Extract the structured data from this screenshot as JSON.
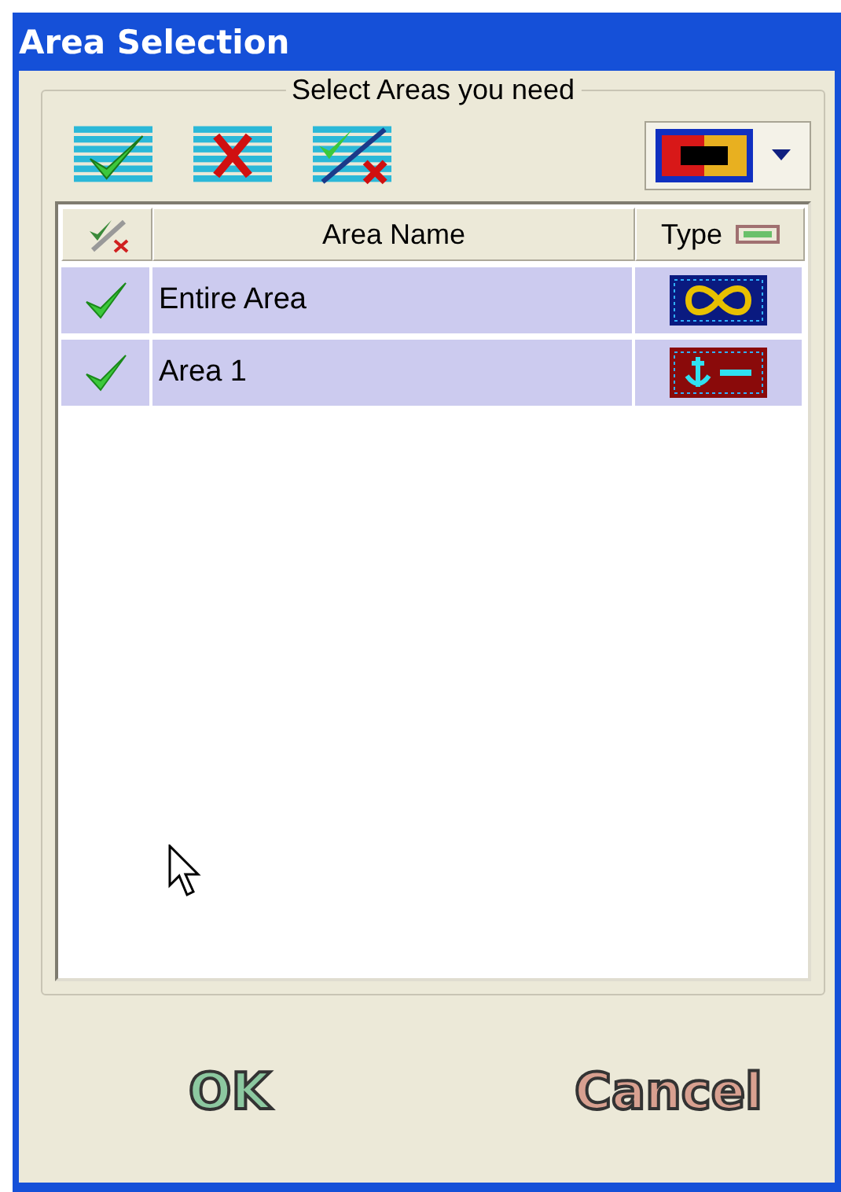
{
  "window": {
    "title": "Area Selection"
  },
  "group": {
    "legend": "Select Areas you need"
  },
  "table": {
    "columns": [
      "Area Name",
      "Type"
    ],
    "rows": [
      {
        "checked": true,
        "selected": true,
        "name": "Entire Area",
        "kind": "infinity"
      },
      {
        "checked": true,
        "selected": true,
        "name": "Area 1",
        "kind": "anchor"
      }
    ]
  },
  "buttons": [
    {
      "label": "OK",
      "kind": "ok"
    },
    {
      "label": "Cancel",
      "kind": "cancel"
    }
  ]
}
